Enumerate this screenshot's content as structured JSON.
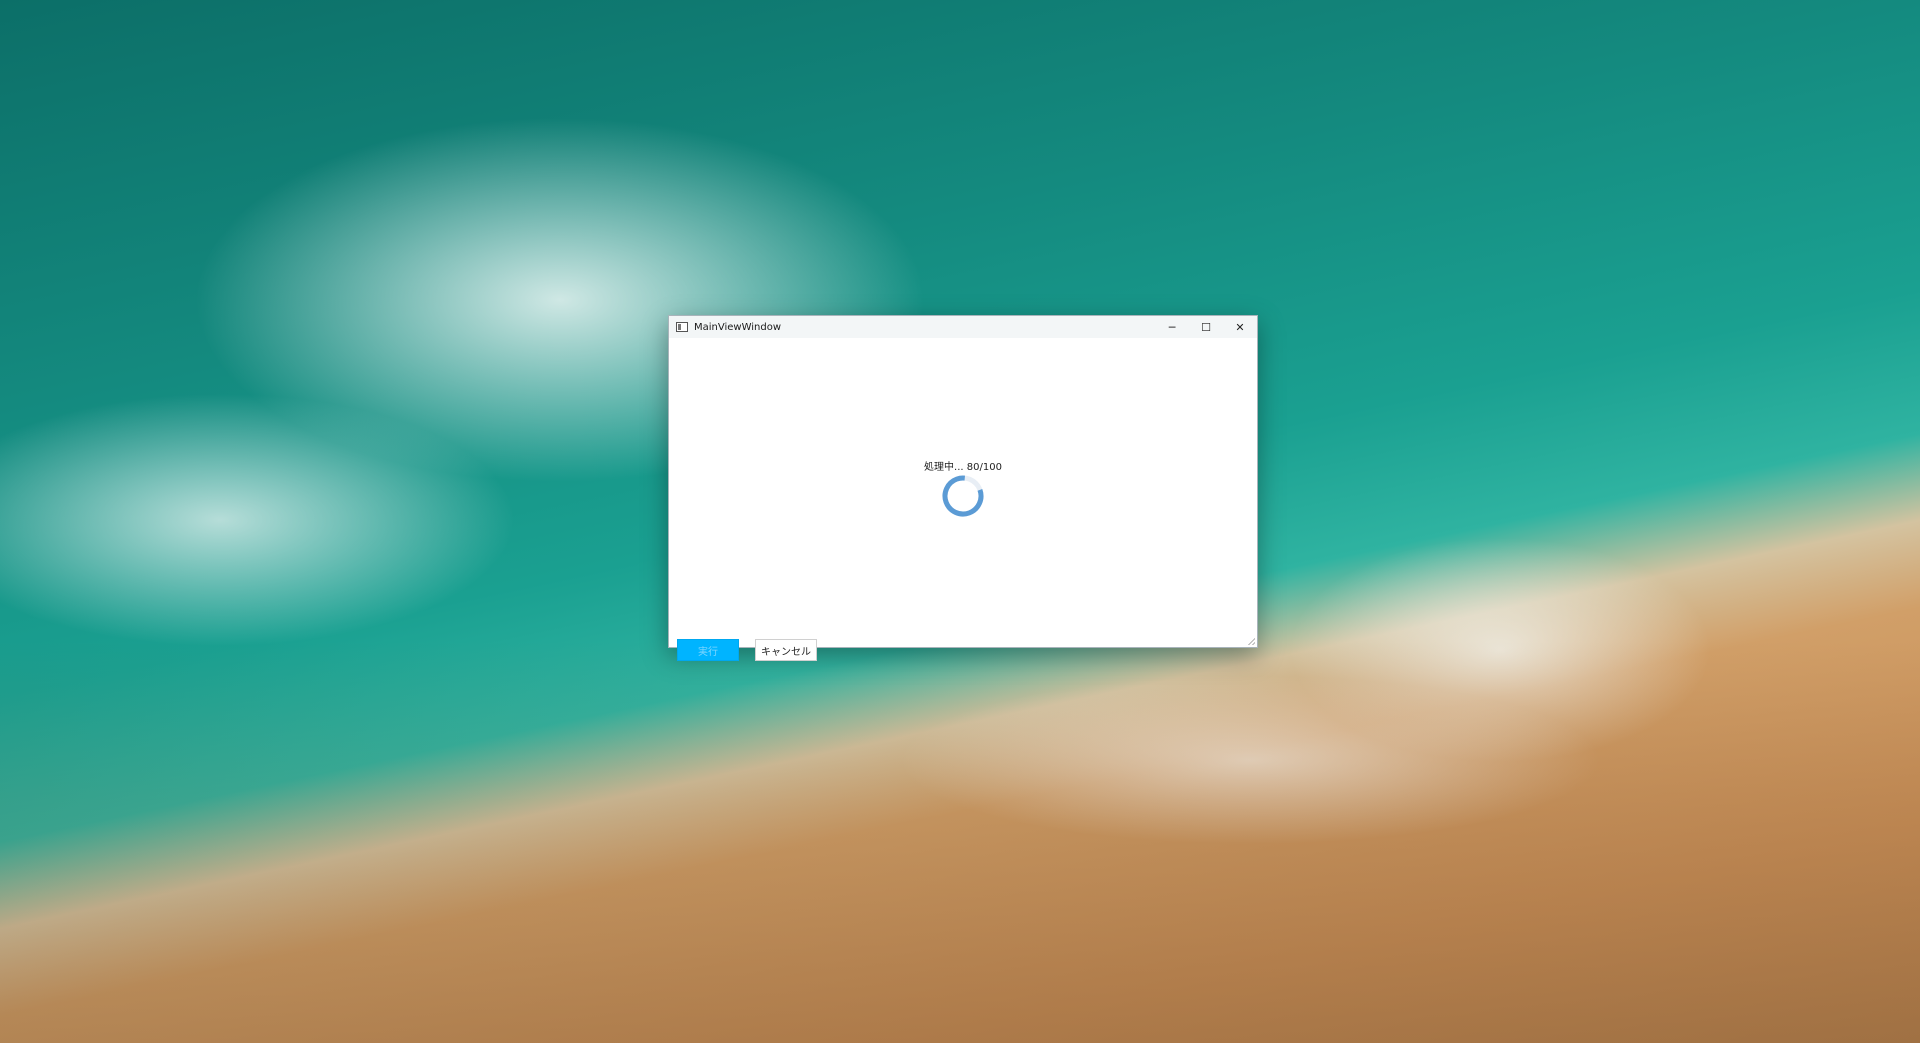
{
  "window": {
    "title": "MainViewWindow",
    "controls": {
      "minimize": "─",
      "maximize": "☐",
      "close": "✕"
    }
  },
  "progress": {
    "status_text": "処理中... 80/100",
    "current": 80,
    "total": 100
  },
  "buttons": {
    "run_label": "実行",
    "cancel_label": "キャンセル"
  },
  "colors": {
    "accent": "#00b4ff",
    "spinner": "#5b9bd5"
  }
}
